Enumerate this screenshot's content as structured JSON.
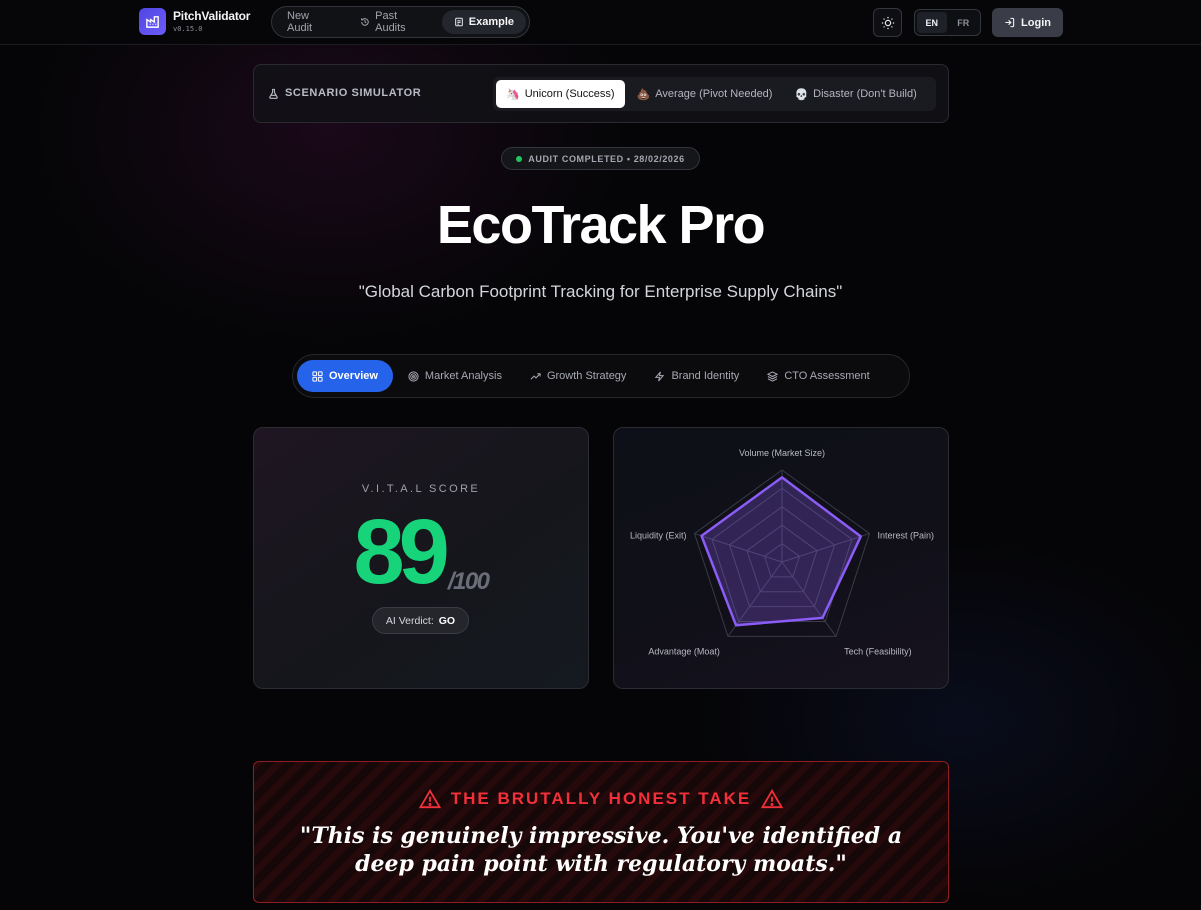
{
  "app": {
    "name": "PitchValidator",
    "version": "v0.15.0"
  },
  "nav": {
    "items": [
      {
        "label": "New Audit",
        "icon": "none"
      },
      {
        "label": "Past Audits",
        "icon": "history-icon"
      },
      {
        "label": "Example",
        "icon": "document-icon",
        "active": true
      }
    ],
    "languages": [
      "EN",
      "FR"
    ],
    "active_language": "EN",
    "login_label": "Login"
  },
  "scenario": {
    "title": "SCENARIO SIMULATOR",
    "options": [
      {
        "emoji": "🦄",
        "label": "Unicorn (Success)",
        "active": true
      },
      {
        "emoji": "💩",
        "label": "Average (Pivot Needed)"
      },
      {
        "emoji": "💀",
        "label": "Disaster (Don't Build)"
      }
    ]
  },
  "audit": {
    "status": "AUDIT COMPLETED • 28/02/2026",
    "status_color": "#22c55e",
    "project_name": "EcoTrack Pro",
    "tagline": "\"Global Carbon Footprint Tracking for Enterprise Supply Chains\""
  },
  "tabs": [
    {
      "label": "Overview",
      "icon": "grid-icon",
      "active": true
    },
    {
      "label": "Market Analysis",
      "icon": "target-icon"
    },
    {
      "label": "Growth Strategy",
      "icon": "trend-up-icon"
    },
    {
      "label": "Brand Identity",
      "icon": "lightning-icon"
    },
    {
      "label": "CTO Assessment",
      "icon": "layers-icon"
    }
  ],
  "score": {
    "label": "V.I.T.A.L SCORE",
    "value": "89",
    "denominator": "/100",
    "verdict_label": "AI Verdict:",
    "verdict_value": "GO",
    "color": "#17d47a"
  },
  "chart_data": {
    "type": "radar",
    "axes": [
      "Volume (Market Size)",
      "Interest (Pain)",
      "Tech (Feasibility)",
      "Advantage (Moat)",
      "Liquidity (Exit)"
    ],
    "values": [
      92,
      90,
      75,
      85,
      92
    ],
    "max": 100,
    "color": "#8b5cf6"
  },
  "honest_take": {
    "title": "THE BRUTALLY HONEST TAKE",
    "quote": "\"This is genuinely impressive. You've identified a deep pain point with regulatory moats.\"",
    "accent": "#f2303a"
  }
}
